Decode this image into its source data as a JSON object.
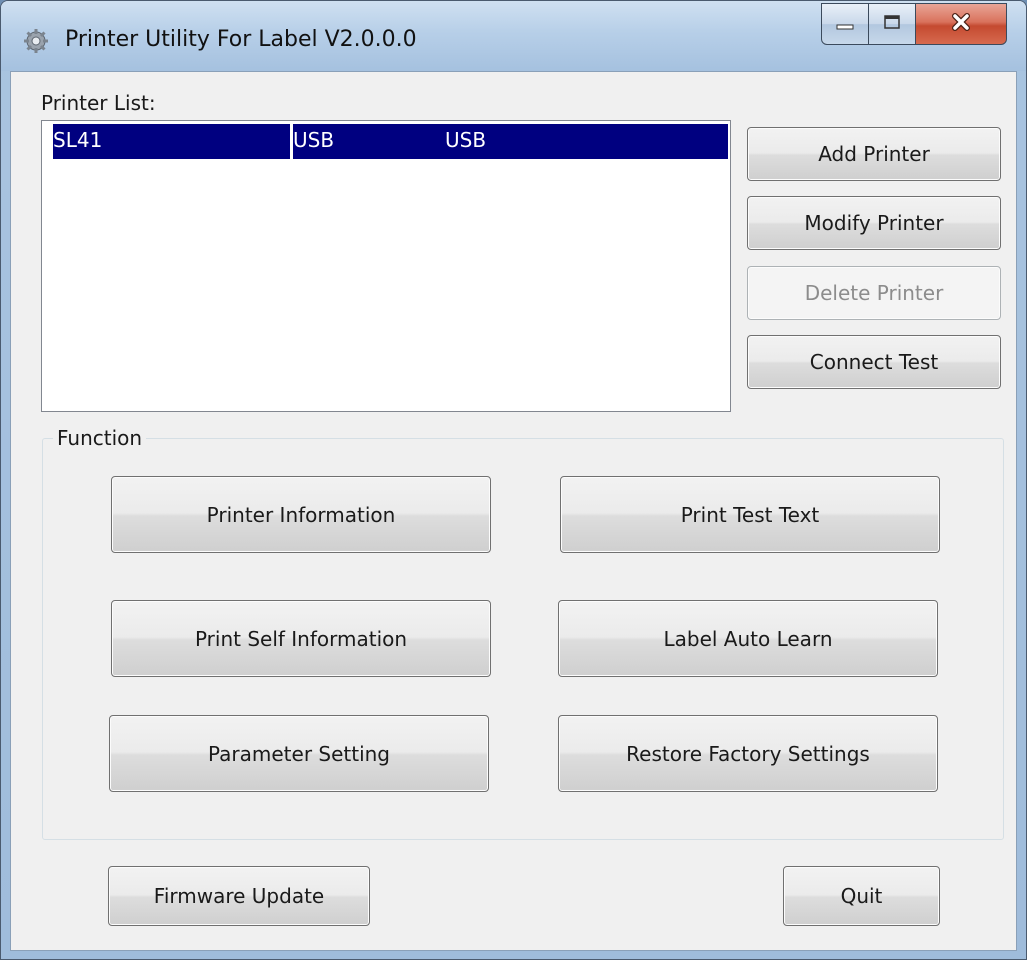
{
  "window": {
    "title": "Printer Utility For Label  V2.0.0.0",
    "icon": "gear-icon",
    "controls": {
      "minimize": "minimize-icon",
      "maximize": "maximize-icon",
      "close": "close-icon"
    }
  },
  "printer_list": {
    "label": "Printer List:",
    "rows": [
      {
        "name": "SL41",
        "port": "USB",
        "type": "USB",
        "selected": true
      }
    ],
    "selection_color": "#000080"
  },
  "side_buttons": {
    "add": "Add Printer",
    "modify": "Modify Printer",
    "delete": "Delete Printer",
    "connect": "Connect Test"
  },
  "function_group": {
    "title": "Function",
    "buttons": {
      "printer_information": "Printer Information",
      "print_test_text": "Print Test Text",
      "print_self_information": "Print Self Information",
      "label_auto_learn": "Label Auto Learn",
      "parameter_setting": "Parameter Setting",
      "restore_factory_settings": "Restore Factory Settings"
    }
  },
  "footer": {
    "firmware_update": "Firmware Update",
    "quit": "Quit"
  }
}
